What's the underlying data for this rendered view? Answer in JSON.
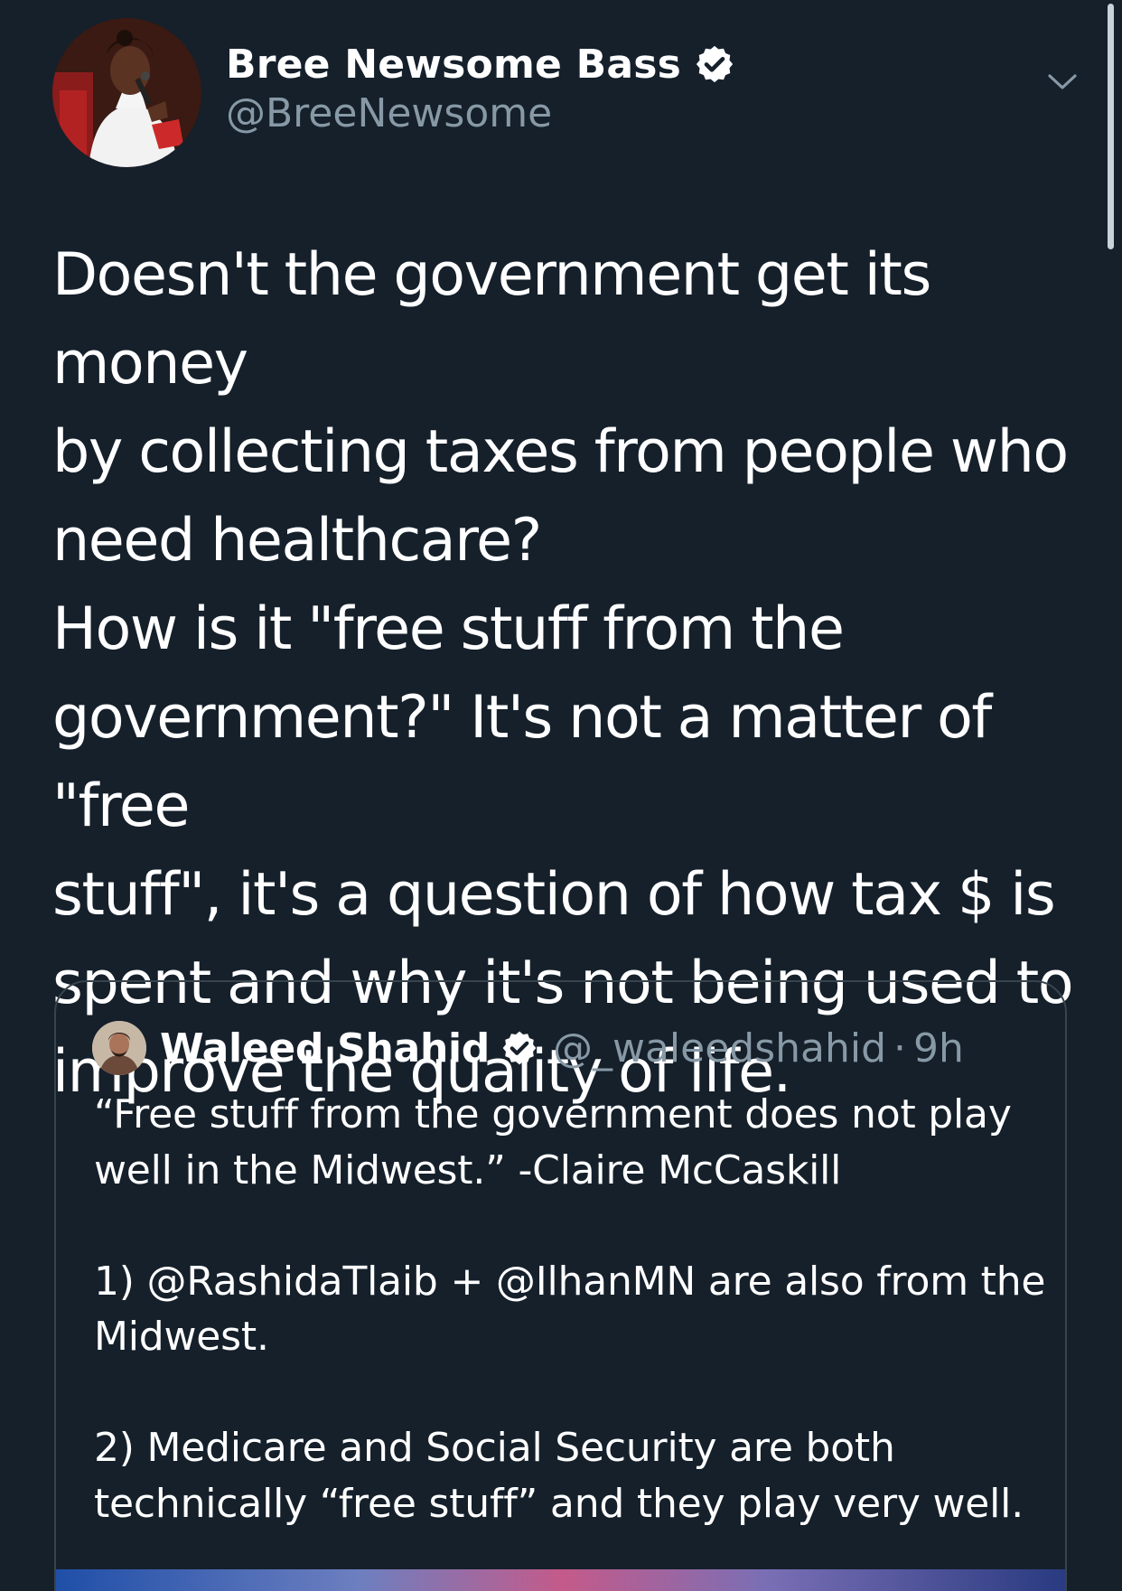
{
  "colors": {
    "background": "#15202b",
    "text_primary": "#ffffff",
    "text_secondary": "#8899a6",
    "verified_badge": "#ffffff",
    "card_border": "#38444d"
  },
  "tweet": {
    "author": {
      "display_name": "Bree Newsome Bass",
      "handle": "@BreeNewsome",
      "verified": true,
      "avatar_icon": "profile-photo"
    },
    "menu_icon": "chevron-down-icon",
    "text": "Doesn't the government get its money\nby collecting taxes from people who\nneed healthcare?\nHow is it \"free stuff from the\ngovernment?\" It's not a matter of \"free\nstuff\", it's a question of how tax $ is\nspent and why it's not being used to\nimprove the quality of life."
  },
  "quoted_tweet": {
    "author": {
      "display_name": "Waleed Shahid",
      "handle": "@_waleedshahid",
      "verified": true,
      "avatar_icon": "profile-photo"
    },
    "separator": "·",
    "time": "9h",
    "text": "“Free stuff from the government does not play\nwell in the Midwest.” -Claire McCaskill\n\n1) @RashidaTlaib + @IlhanMN are also from the\nMidwest.\n\n2) Medicare and Social Security are both\ntechnically “free stuff” and they play very well."
  }
}
